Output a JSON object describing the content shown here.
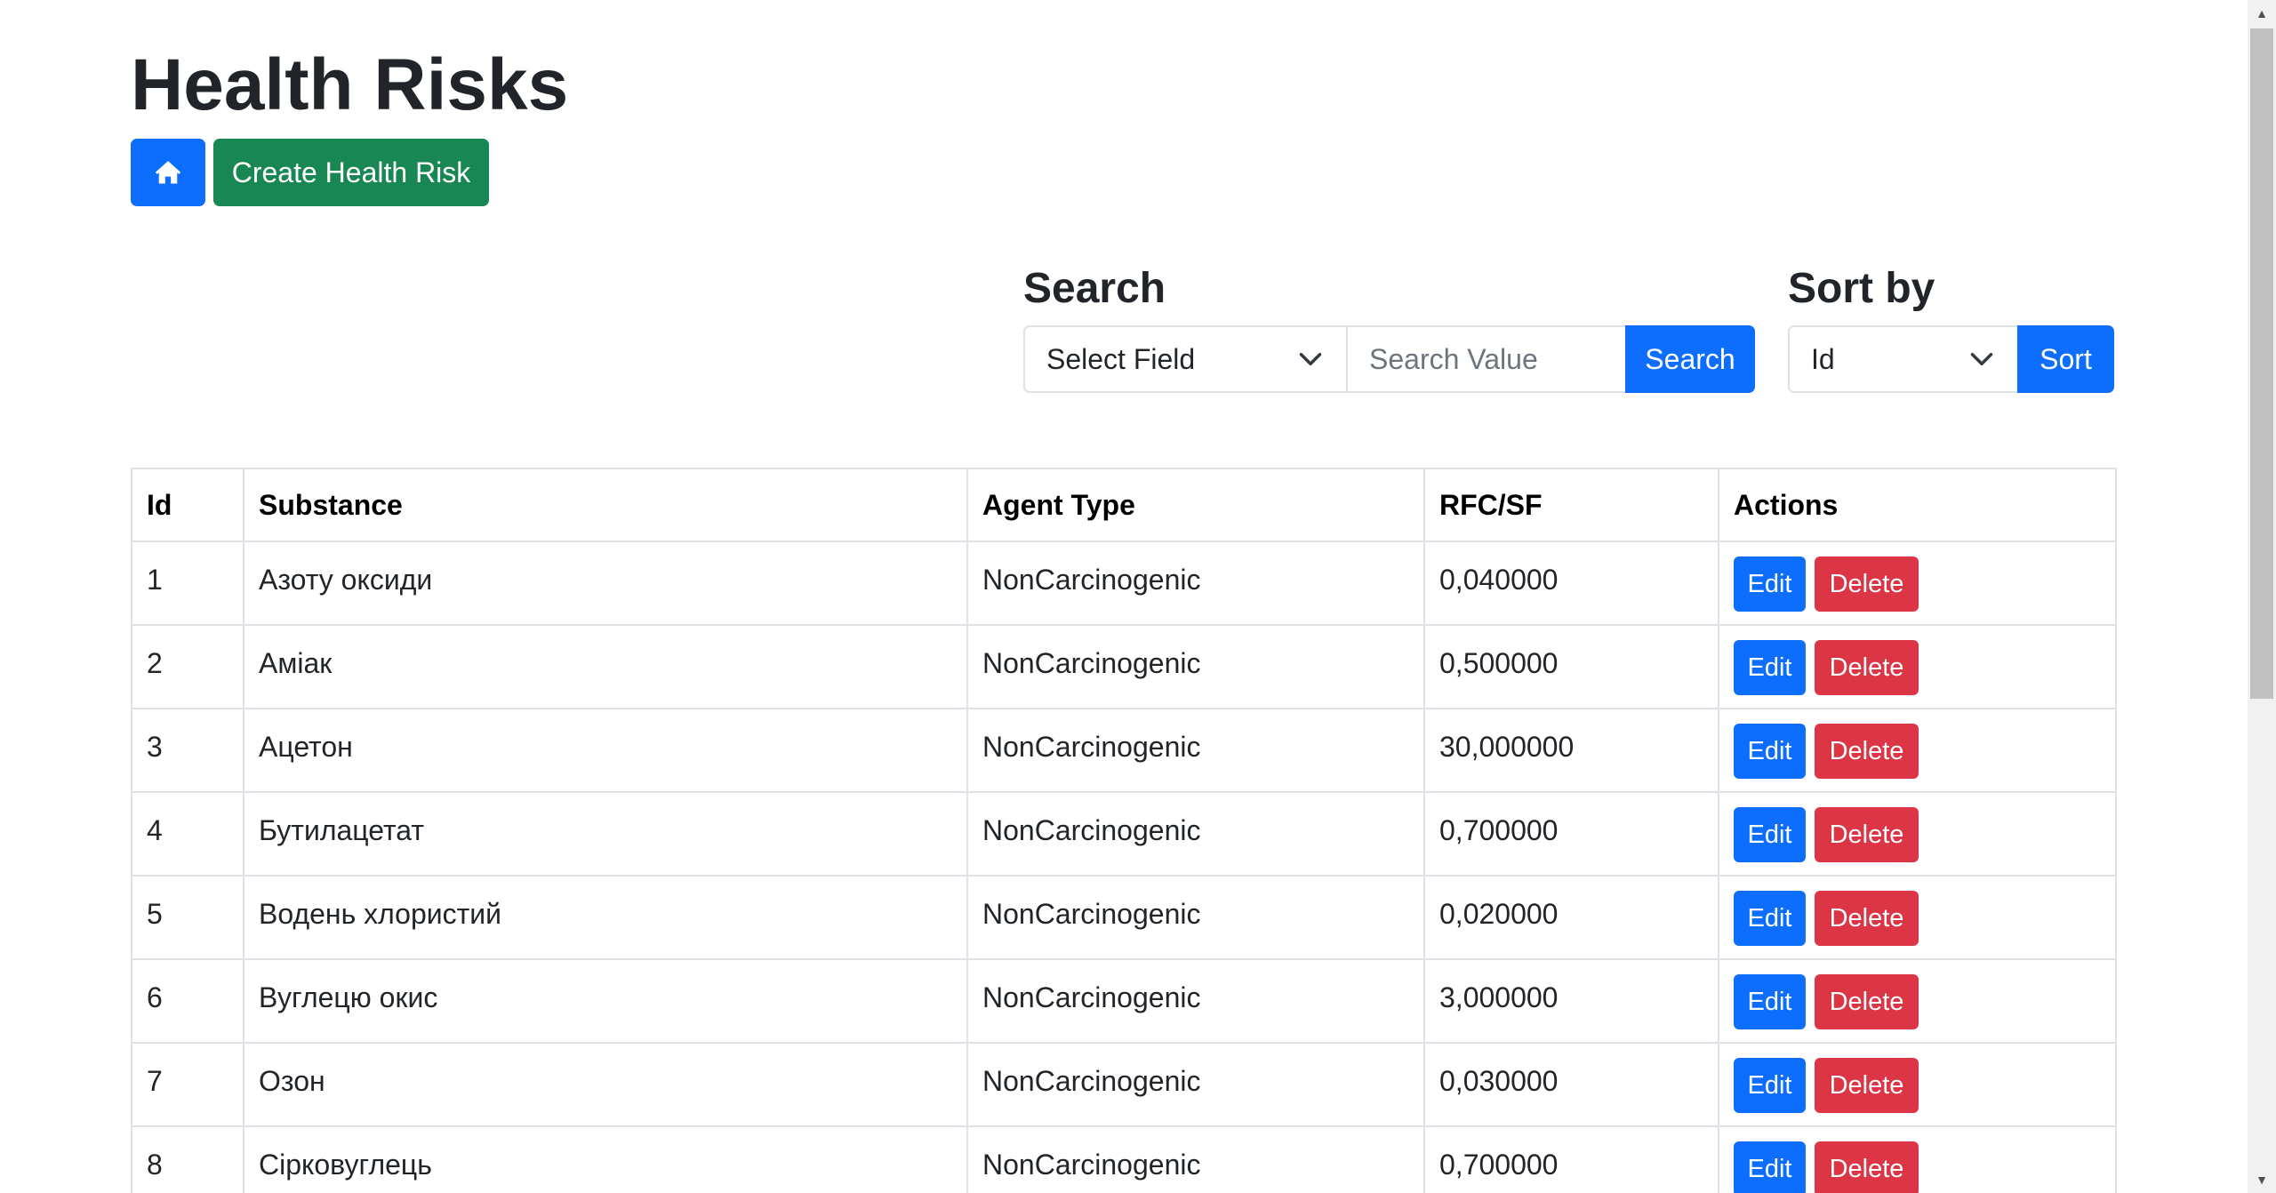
{
  "page": {
    "title": "Health Risks"
  },
  "top_actions": {
    "home_icon": "home-icon",
    "create_label": "Create Health Risk"
  },
  "search": {
    "label": "Search",
    "field_select_value": "Select Field",
    "value_placeholder": "Search Value",
    "button_label": "Search"
  },
  "sort": {
    "label": "Sort by",
    "select_value": "Id",
    "button_label": "Sort"
  },
  "table": {
    "headers": {
      "id": "Id",
      "substance": "Substance",
      "agent_type": "Agent Type",
      "rfc_sf": "RFC/SF",
      "actions": "Actions"
    },
    "rows": [
      {
        "id": "1",
        "substance": "Азоту оксиди",
        "agent_type": "NonCarcinogenic",
        "rfc_sf": "0,040000",
        "edit": "Edit",
        "delete": "Delete"
      },
      {
        "id": "2",
        "substance": "Аміак",
        "agent_type": "NonCarcinogenic",
        "rfc_sf": "0,500000",
        "edit": "Edit",
        "delete": "Delete"
      },
      {
        "id": "3",
        "substance": "Ацетон",
        "agent_type": "NonCarcinogenic",
        "rfc_sf": "30,000000",
        "edit": "Edit",
        "delete": "Delete"
      },
      {
        "id": "4",
        "substance": "Бутилацетат",
        "agent_type": "NonCarcinogenic",
        "rfc_sf": "0,700000",
        "edit": "Edit",
        "delete": "Delete"
      },
      {
        "id": "5",
        "substance": "Водень хлористий",
        "agent_type": "NonCarcinogenic",
        "rfc_sf": "0,020000",
        "edit": "Edit",
        "delete": "Delete"
      },
      {
        "id": "6",
        "substance": "Вуглецю окис",
        "agent_type": "NonCarcinogenic",
        "rfc_sf": "3,000000",
        "edit": "Edit",
        "delete": "Delete"
      },
      {
        "id": "7",
        "substance": "Озон",
        "agent_type": "NonCarcinogenic",
        "rfc_sf": "0,030000",
        "edit": "Edit",
        "delete": "Delete"
      },
      {
        "id": "8",
        "substance": "Сірковуглець",
        "agent_type": "NonCarcinogenic",
        "rfc_sf": "0,700000",
        "edit": "Edit",
        "delete": "Delete"
      }
    ]
  },
  "colors": {
    "primary": "#0d6efd",
    "success": "#198754",
    "danger": "#dc3545",
    "border": "#dee2e6"
  }
}
